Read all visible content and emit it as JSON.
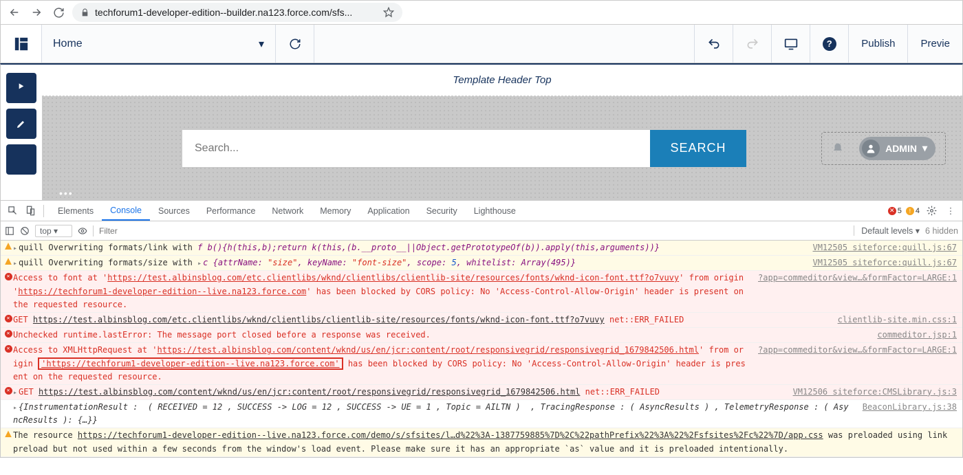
{
  "browser": {
    "url": "techforum1-developer-edition--builder.na123.force.com/sfs..."
  },
  "builder": {
    "page": "Home",
    "publish": "Publish",
    "preview": "Previe"
  },
  "canvas": {
    "template_header": "Template Header Top",
    "search_placeholder": "Search...",
    "search_button": "SEARCH",
    "user": "ADMIN"
  },
  "devtools": {
    "tabs": [
      "Elements",
      "Console",
      "Sources",
      "Performance",
      "Network",
      "Memory",
      "Application",
      "Security",
      "Lighthouse"
    ],
    "active_tab": 1,
    "err_count": "5",
    "warn_count": "4",
    "context": "top",
    "filter_placeholder": "Filter",
    "levels": "Default levels",
    "hidden": "6 hidden"
  },
  "log": [
    {
      "t": "warn",
      "src": "VM12505 siteforce:quill.js:67",
      "parts": [
        {
          "k": "arrow"
        },
        {
          "k": "txt",
          "v": "quill Overwriting formats/link with "
        },
        {
          "k": "i",
          "v": "f b(){h(this,b);return k(this,(b.__proto__||Object.getPrototypeOf(b)).apply(this,arguments))}",
          "c": "cpurp"
        }
      ]
    },
    {
      "t": "warn",
      "src": "VM12505 siteforce:quill.js:67",
      "parts": [
        {
          "k": "arrow"
        },
        {
          "k": "txt",
          "v": "quill Overwriting formats/size with "
        },
        {
          "k": "arrow"
        },
        {
          "k": "i",
          "v": "c {attrName: ",
          "c": "cpurp"
        },
        {
          "k": "i",
          "v": "\"size\"",
          "c": "cred"
        },
        {
          "k": "i",
          "v": ", keyName: ",
          "c": "cpurp"
        },
        {
          "k": "i",
          "v": "\"font-size\"",
          "c": "cred"
        },
        {
          "k": "i",
          "v": ", scope: ",
          "c": "cpurp"
        },
        {
          "k": "i",
          "v": "5",
          "c": "cblue"
        },
        {
          "k": "i",
          "v": ", whitelist: Array(495)}",
          "c": "cpurp"
        }
      ]
    },
    {
      "t": "err",
      "src": "?app=commeditor&view…&formFactor=LARGE:1",
      "parts": [
        {
          "k": "txt",
          "v": "Access to font at '",
          "c": "cred"
        },
        {
          "k": "u",
          "v": "https://test.albinsblog.com/etc.clientlibs/wknd/clientlibs/clientlib-site/resources/fonts/wknd-icon-font.ttf?o7vuvy",
          "c": "cred"
        },
        {
          "k": "txt",
          "v": "' from origin '",
          "c": "cred"
        },
        {
          "k": "u",
          "v": "https://techforum1-developer-edition--live.na123.force.com",
          "c": "cred"
        },
        {
          "k": "txt",
          "v": "' has been blocked by CORS policy: No 'Access-Control-Allow-Origin' header is present on the requested resource.",
          "c": "cred"
        }
      ]
    },
    {
      "t": "err",
      "src": "clientlib-site.min.css:1",
      "parts": [
        {
          "k": "txt",
          "v": "GET ",
          "c": "cred"
        },
        {
          "k": "u",
          "v": "https://test.albinsblog.com/etc.clientlibs/wknd/clientlibs/clientlib-site/resources/fonts/wknd-icon-font.ttf?o7vuvy"
        },
        {
          "k": "txt",
          "v": " net::ERR_FAILED",
          "c": "cred"
        }
      ]
    },
    {
      "t": "err",
      "src": "commeditor.jsp:1",
      "parts": [
        {
          "k": "txt",
          "v": "Unchecked runtime.lastError: The message port closed before a response was received.",
          "c": "cred"
        }
      ]
    },
    {
      "t": "err",
      "src": "?app=commeditor&view…&formFactor=LARGE:1",
      "parts": [
        {
          "k": "txt",
          "v": "Access to XMLHttpRequest at '",
          "c": "cred"
        },
        {
          "k": "u",
          "v": "https://test.albinsblog.com/content/wknd/us/en/jcr:content/root/responsivegrid/responsivegrid_1679842506.html",
          "c": "cred"
        },
        {
          "k": "txt",
          "v": "' from origin ",
          "c": "cred"
        },
        {
          "k": "box",
          "v": "'https://techforum1-developer-edition--live.na123.force.com'",
          "c": "cred"
        },
        {
          "k": "txt",
          "v": " has been blocked by CORS policy: No 'Access-Control-Allow-Origin' header is present on the requested resource.",
          "c": "cred"
        }
      ]
    },
    {
      "t": "err",
      "src": "VM12506 siteforce:CMSLibrary.js:3",
      "parts": [
        {
          "k": "arrow"
        },
        {
          "k": "txt",
          "v": "GET ",
          "c": "cred"
        },
        {
          "k": "u",
          "v": "https://test.albinsblog.com/content/wknd/us/en/jcr:content/root/responsivegrid/responsivegrid_1679842506.html"
        },
        {
          "k": "txt",
          "v": " net::ERR_FAILED",
          "c": "cred"
        }
      ]
    },
    {
      "t": "info",
      "src": "BeaconLibrary.js:38",
      "parts": [
        {
          "k": "arrow"
        },
        {
          "k": "i",
          "v": "{InstrumentationResult :  ( RECEIVED = 12 , SUCCESS -> LOG = 12 , SUCCESS -> UE = 1 , Topic = AILTN )  , TracingResponse : ( AsyncResults ) , TelemetryResponse : ( AsyncResults ): {…}}"
        }
      ]
    },
    {
      "t": "warn",
      "src": "",
      "parts": [
        {
          "k": "txt",
          "v": "The resource "
        },
        {
          "k": "u",
          "v": "https://techforum1-developer-edition--live.na123.force.com/demo/s/sfsites/l…d%22%3A-1387759885%7D%2C%22pathPrefix%22%3A%22%2Fsfsites%2Fc%22%7D/app.css"
        },
        {
          "k": "txt",
          "v": " was preloaded using link preload but not used within a few seconds from the window's load event. Please make sure it has an appropriate `as` value and it is preloaded intentionally."
        }
      ]
    }
  ]
}
